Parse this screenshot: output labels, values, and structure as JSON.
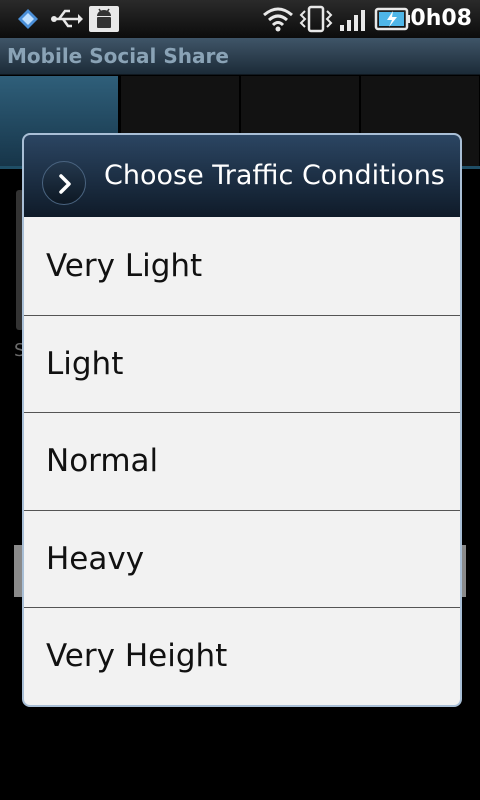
{
  "status_bar": {
    "time": "0h08",
    "icons": [
      "app-icon",
      "usb-icon",
      "android-debug-icon",
      "wifi-icon",
      "vibrate-icon",
      "signal-icon",
      "battery-charging-icon"
    ]
  },
  "app": {
    "title": "Mobile Social Share"
  },
  "background": {
    "partial_char": "S"
  },
  "dialog": {
    "icon": "chevron-right-icon",
    "title": "Choose Traffic Conditions",
    "options": [
      {
        "label": "Very Light"
      },
      {
        "label": "Light"
      },
      {
        "label": "Normal"
      },
      {
        "label": "Heavy"
      },
      {
        "label": "Very Height"
      }
    ]
  },
  "colors": {
    "dialog_header": "#1b2e44",
    "dialog_border": "#a9bfd6",
    "dialog_body": "#f2f2f2",
    "title_bar": "#2c4255",
    "active_tab": "#24506a"
  }
}
